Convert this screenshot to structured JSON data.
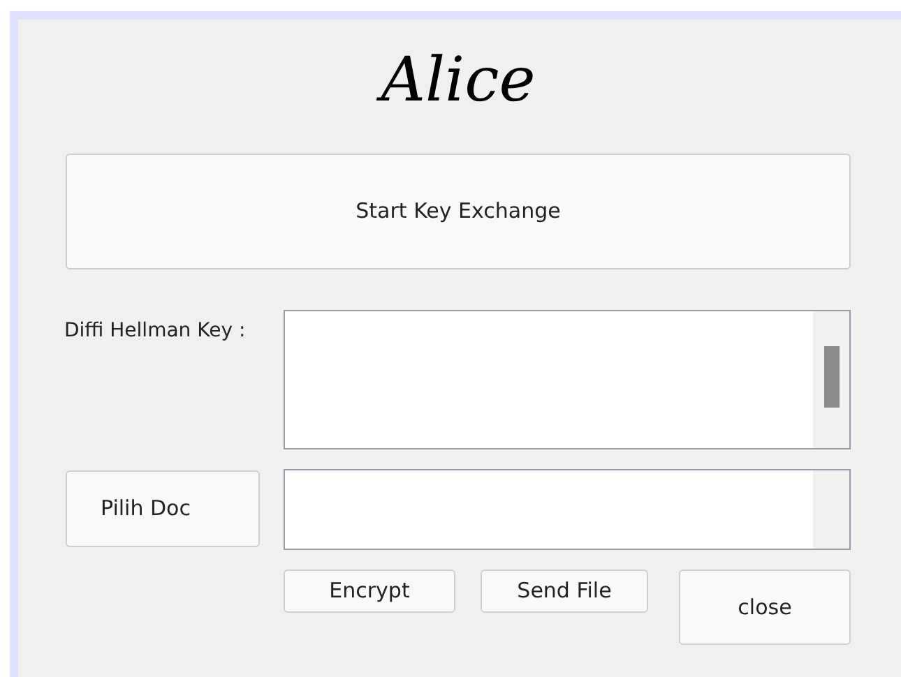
{
  "title": "Alice",
  "start_button": "Start Key Exchange",
  "key_label": "Diffi Hellman Key :",
  "choose_button": "Pilih Doc",
  "buttons": [
    {
      "kind": "encrypt",
      "label": "Encrypt"
    },
    {
      "kind": "send",
      "label": "Send File"
    },
    {
      "kind": "close",
      "label": "close"
    }
  ]
}
